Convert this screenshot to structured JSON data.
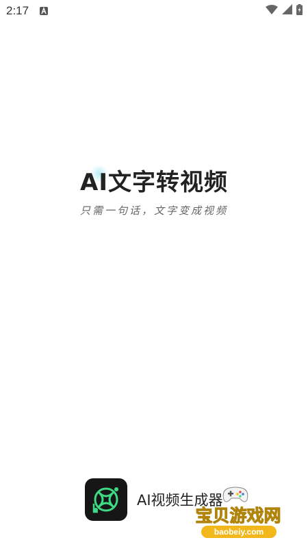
{
  "status_bar": {
    "time": "2:17",
    "icons": [
      "notification-a-icon",
      "wifi-icon",
      "cell-signal-icon",
      "battery-charging-icon"
    ]
  },
  "splash": {
    "title": "AI文字转视频",
    "subtitle": "只需一句话，文字变成视频"
  },
  "app": {
    "name": "AI视频生成器",
    "logo_icon": "app-logo-icon",
    "accent_color": "#3ddc84"
  },
  "watermark": {
    "text": "宝贝游戏网",
    "url": "baobeiy.com",
    "color": "#f2c21b"
  }
}
